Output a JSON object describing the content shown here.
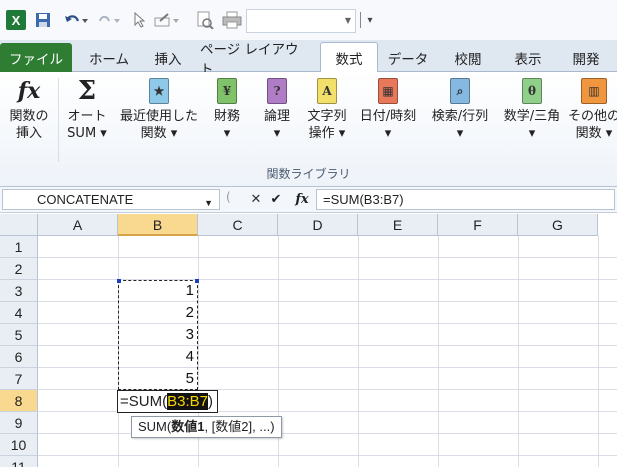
{
  "app": {
    "logo": "X"
  },
  "qat": {
    "custom_label": "▾"
  },
  "tabs": [
    {
      "label": "ファイル"
    },
    {
      "label": "ホーム"
    },
    {
      "label": "挿入"
    },
    {
      "label": "ページ レイアウト"
    },
    {
      "label": "数式"
    },
    {
      "label": "データ"
    },
    {
      "label": "校閲"
    },
    {
      "label": "表示"
    },
    {
      "label": "開発"
    }
  ],
  "ribbon": {
    "insert_function": {
      "line1": "関数の",
      "line2": "挿入"
    },
    "autosum": {
      "line1": "オート",
      "line2": "SUM ▾"
    },
    "recent": {
      "line1": "最近使用した",
      "line2": "関数 ▾"
    },
    "finance": {
      "line1": "財務",
      "line2": "▾"
    },
    "logic": {
      "line1": "論理",
      "line2": "▾"
    },
    "text": {
      "line1": "文字列",
      "line2": "操作 ▾"
    },
    "date": {
      "line1": "日付/時刻",
      "line2": "▾"
    },
    "lookup": {
      "line1": "検索/行列",
      "line2": "▾"
    },
    "math": {
      "line1": "数学/三角",
      "line2": "▾"
    },
    "more": {
      "line1": "その他の",
      "line2": "関数 ▾"
    },
    "group_label": "関数ライブラリ"
  },
  "formula_bar": {
    "name_box": "CONCATENATE",
    "formula": "=SUM(B3:B7)"
  },
  "grid": {
    "columns": [
      "A",
      "B",
      "C",
      "D",
      "E",
      "F",
      "G"
    ],
    "rows": [
      "1",
      "2",
      "3",
      "4",
      "5",
      "6",
      "7",
      "8",
      "9",
      "10",
      "11"
    ],
    "active_column": "B",
    "active_row": "8",
    "values_B": [
      "1",
      "2",
      "3",
      "4",
      "5"
    ],
    "edit_prefix": "=SUM(",
    "edit_ref": "B3:B7",
    "edit_suffix": ")",
    "tooltip": {
      "func": "SUM(",
      "arg1": "数値1",
      "rest": ", [数値2], ...)"
    }
  },
  "colors": {
    "file_tab": "#2e7d32",
    "active_header": "#f9d890",
    "ref_highlight": "#f5d500"
  }
}
